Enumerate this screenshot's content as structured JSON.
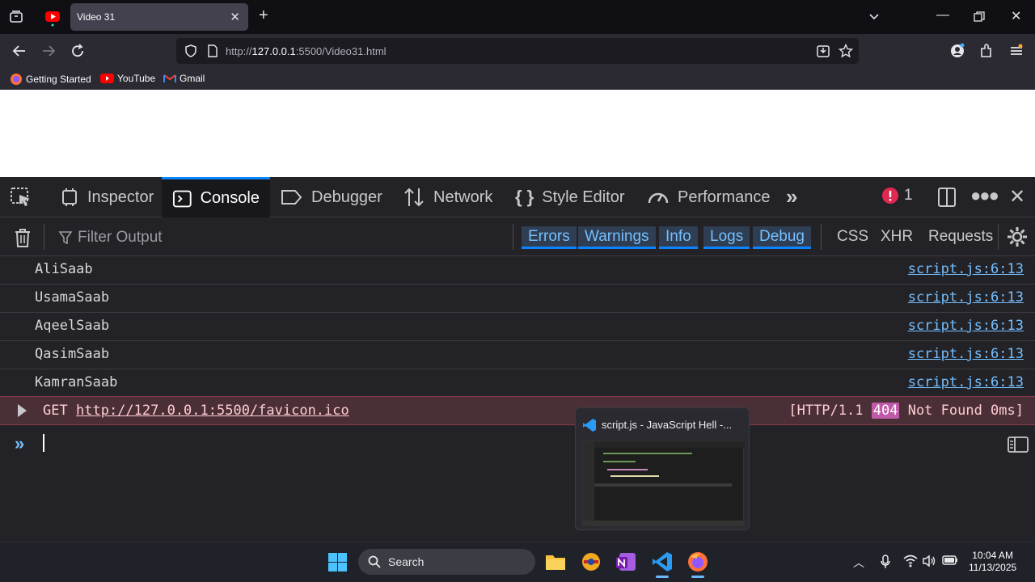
{
  "browser": {
    "tab_title": "Video 31",
    "url_prefix": "http://",
    "url_host": "127.0.0.1",
    "url_rest": ":5500/Video31.html",
    "bookmarks": [
      "Getting Started",
      "YouTube",
      "Gmail"
    ]
  },
  "devtools": {
    "tabs": [
      "Inspector",
      "Console",
      "Debugger",
      "Network",
      "Style Editor",
      "Performance"
    ],
    "active_tab": "Console",
    "error_count": "1",
    "filter_placeholder": "Filter Output",
    "filter_buttons": [
      "Errors",
      "Warnings",
      "Info",
      "Logs",
      "Debug"
    ],
    "type_buttons": [
      "CSS",
      "XHR",
      "Requests"
    ]
  },
  "console": {
    "logs": [
      {
        "message": "AliSaab",
        "source": "script.js:6:13"
      },
      {
        "message": "UsamaSaab",
        "source": "script.js:6:13"
      },
      {
        "message": "AqeelSaab",
        "source": "script.js:6:13"
      },
      {
        "message": "QasimSaab",
        "source": "script.js:6:13"
      },
      {
        "message": "KamranSaab",
        "source": "script.js:6:13"
      }
    ],
    "error": {
      "method": "GET",
      "url": "http://127.0.0.1:5500/favicon.ico",
      "status_prefix": "[HTTP/1.1",
      "status_code": "404",
      "status_suffix": "Not Found 0ms]"
    }
  },
  "thumbnail": {
    "title": "script.js - JavaScript Hell -..."
  },
  "taskbar": {
    "search_placeholder": "Search",
    "time": "10:04 AM",
    "date": "11/13/2025"
  },
  "colors": {
    "accent": "#0a84ff",
    "link": "#75bfff",
    "error_bg": "#4b2f36",
    "status_badge": "#c05aa8"
  }
}
